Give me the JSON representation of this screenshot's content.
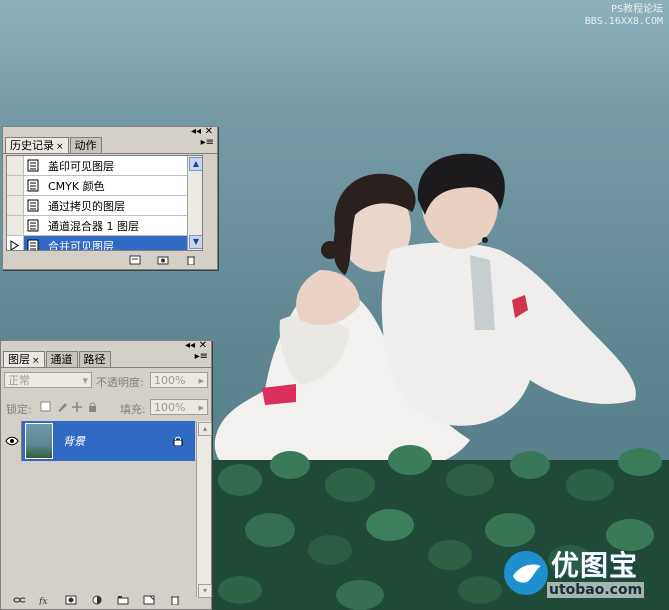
{
  "watermark": {
    "top_line1": "PS教程论坛",
    "top_line2": "BBS.16XX8.COM",
    "logo_cn": "优图宝",
    "logo_en": "utobao.com"
  },
  "history_panel": {
    "tabs": [
      {
        "label": "历史记录",
        "active": true,
        "closable": true
      },
      {
        "label": "动作",
        "active": false,
        "closable": false
      }
    ],
    "close_glyph": "×",
    "items": [
      {
        "label": "盖印可见图层",
        "selected": false
      },
      {
        "label": "CMYK 颜色",
        "selected": false
      },
      {
        "label": "通过拷贝的图层",
        "selected": false
      },
      {
        "label": "通道混合器 1 图层",
        "selected": false
      },
      {
        "label": "合并可见图层",
        "selected": true
      }
    ],
    "footer_icons": [
      "new-document-from-state-icon",
      "snapshot-icon",
      "trash-icon"
    ]
  },
  "layers_panel": {
    "tabs": [
      {
        "label": "图层",
        "active": true,
        "closable": true
      },
      {
        "label": "通道",
        "active": false,
        "closable": false
      },
      {
        "label": "路径",
        "active": false,
        "closable": false
      }
    ],
    "close_glyph": "×",
    "blend_mode": "正常",
    "opacity_label": "不透明度:",
    "opacity_value": "100%",
    "lock_label": "锁定:",
    "fill_label": "填充:",
    "fill_value": "100%",
    "layers": [
      {
        "name": "背景",
        "visible": true,
        "locked": true,
        "selected": true
      }
    ],
    "footer_icons": [
      "link-icon",
      "fx-icon",
      "mask-icon",
      "adjustment-icon",
      "group-icon",
      "new-layer-icon",
      "trash-icon"
    ]
  },
  "colors": {
    "selection": "#316ac5",
    "panel_bg": "#d4d0c8"
  }
}
